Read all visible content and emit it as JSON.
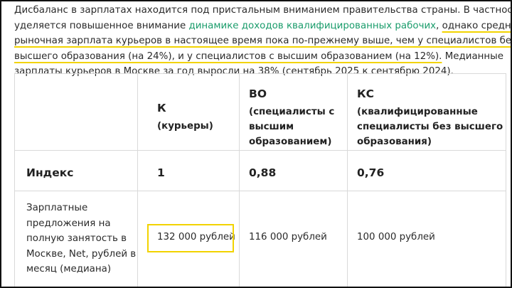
{
  "paragraph": {
    "l1": "Дисбаланс в зарплатах находится под пристальным вниманием правительства страны. В частности,",
    "l2_pre": "уделяется повышенное внимание ",
    "l2_link": "динамике доходов квалифицированных рабочих",
    "l2_mid": ", ",
    "l2_hl": "однако средняя",
    "l3_hl": "рыночная зарплата курьеров в настоящее время пока по-прежнему выше, чем у специалистов без",
    "l4_hl": "высшего образования (на 24%), и у специалистов с высшим образованием (на 12%).",
    "l4_post": " Медианные",
    "l5": "зарплаты курьеров в Москве за год выросли на 38% (сентябрь 2025 к сентябрю 2024)."
  },
  "table": {
    "headers": [
      {
        "code": "К",
        "desc": [
          "(курьеры)"
        ]
      },
      {
        "code": "ВО",
        "desc": [
          "(специалисты с",
          "высшим",
          "образованием)"
        ]
      },
      {
        "code": "КС",
        "desc": [
          "(квалифицированные",
          "специалисты без высшего",
          "образования)"
        ]
      }
    ],
    "index_row": {
      "label": "Индекс",
      "values": [
        "1",
        "0,88",
        "0,76"
      ]
    },
    "salary_row": {
      "label": [
        "Зарплатные",
        "предложения на",
        "полную занятость в",
        "Москве, Net, рублей в",
        "месяц (медиана)"
      ],
      "values": [
        "132 000 рублей",
        "116 000 рублей",
        "100 000 рублей"
      ]
    }
  },
  "colors": {
    "highlight": "#f2d300",
    "link": "#1a9c6b"
  }
}
